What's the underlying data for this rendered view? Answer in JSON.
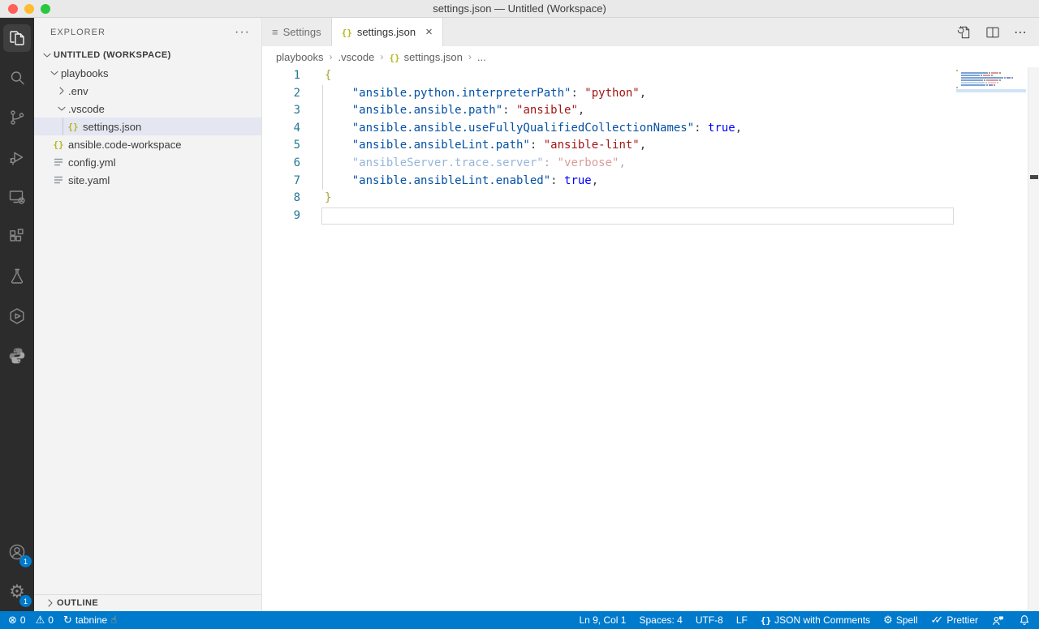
{
  "window": {
    "title": "settings.json — Untitled (Workspace)",
    "controls": [
      "close",
      "minimize",
      "zoom"
    ]
  },
  "activity_bar": {
    "top": [
      {
        "name": "explorer",
        "active": true
      },
      {
        "name": "search",
        "active": false
      },
      {
        "name": "source-control",
        "active": false
      },
      {
        "name": "run-debug",
        "active": false
      },
      {
        "name": "remote-explorer",
        "active": false
      },
      {
        "name": "extensions",
        "active": false
      },
      {
        "name": "testing",
        "active": false
      },
      {
        "name": "hexagon-extension",
        "active": false
      },
      {
        "name": "python",
        "active": false
      }
    ],
    "bottom": [
      {
        "name": "accounts",
        "badge": "1"
      },
      {
        "name": "manage",
        "badge": "1"
      }
    ]
  },
  "sidebar": {
    "title": "EXPLORER",
    "tree": [
      {
        "label": "UNTITLED (WORKSPACE)",
        "type": "section",
        "chevron": "down",
        "indent": 0,
        "bold": true
      },
      {
        "label": "playbooks",
        "type": "folder",
        "chevron": "down",
        "indent": 1
      },
      {
        "label": ".env",
        "type": "folder",
        "chevron": "right",
        "indent": 2
      },
      {
        "label": ".vscode",
        "type": "folder",
        "chevron": "down",
        "indent": 2
      },
      {
        "label": "settings.json",
        "type": "file",
        "icon": "json",
        "indent": 3,
        "selected": true,
        "guide": true
      },
      {
        "label": "ansible.code-workspace",
        "type": "file",
        "icon": "json",
        "indent": 1
      },
      {
        "label": "config.yml",
        "type": "file",
        "icon": "yaml",
        "indent": 1
      },
      {
        "label": "site.yaml",
        "type": "file",
        "icon": "yaml",
        "indent": 1
      }
    ],
    "outline": {
      "label": "OUTLINE"
    }
  },
  "tabs": [
    {
      "label": "Settings",
      "icon": "settings-editor",
      "active": false,
      "close": false
    },
    {
      "label": "settings.json",
      "icon": "json",
      "active": true,
      "close": true
    }
  ],
  "editor_actions": [
    {
      "name": "open-settings-ui"
    },
    {
      "name": "split-editor"
    },
    {
      "name": "more-actions"
    }
  ],
  "breadcrumbs": [
    {
      "label": "playbooks"
    },
    {
      "label": ".vscode"
    },
    {
      "label": "settings.json",
      "icon": "json"
    },
    {
      "label": "..."
    }
  ],
  "editor": {
    "cursor": {
      "line": 9,
      "col": 1
    },
    "lines": [
      {
        "num": "1",
        "indent": 0,
        "segments": [
          {
            "text": "{",
            "style": "bracket"
          }
        ]
      },
      {
        "num": "2",
        "indent": 4,
        "segments": [
          {
            "text": "\"ansible.python.interpreterPath\"",
            "style": "key"
          },
          {
            "text": ": ",
            "style": "punct"
          },
          {
            "text": "\"python\"",
            "style": "str"
          },
          {
            "text": ",",
            "style": "punct"
          }
        ]
      },
      {
        "num": "3",
        "indent": 4,
        "segments": [
          {
            "text": "\"ansible.ansible.path\"",
            "style": "key"
          },
          {
            "text": ": ",
            "style": "punct"
          },
          {
            "text": "\"ansible\"",
            "style": "str"
          },
          {
            "text": ",",
            "style": "punct"
          }
        ]
      },
      {
        "num": "4",
        "indent": 4,
        "segments": [
          {
            "text": "\"ansible.ansible.useFullyQualifiedCollectionNames\"",
            "style": "key"
          },
          {
            "text": ": ",
            "style": "punct"
          },
          {
            "text": "true",
            "style": "bool"
          },
          {
            "text": ",",
            "style": "punct"
          }
        ]
      },
      {
        "num": "5",
        "indent": 4,
        "segments": [
          {
            "text": "\"ansible.ansibleLint.path\"",
            "style": "key"
          },
          {
            "text": ": ",
            "style": "punct"
          },
          {
            "text": "\"ansible-lint\"",
            "style": "str"
          },
          {
            "text": ",",
            "style": "punct"
          }
        ]
      },
      {
        "num": "6",
        "indent": 4,
        "faded": true,
        "segments": [
          {
            "text": "\"ansibleServer.trace.server\"",
            "style": "key"
          },
          {
            "text": ": ",
            "style": "punct"
          },
          {
            "text": "\"verbose\"",
            "style": "str"
          },
          {
            "text": ",",
            "style": "punct"
          }
        ]
      },
      {
        "num": "7",
        "indent": 4,
        "segments": [
          {
            "text": "\"ansible.ansibleLint.enabled\"",
            "style": "key"
          },
          {
            "text": ": ",
            "style": "punct"
          },
          {
            "text": "true",
            "style": "bool"
          },
          {
            "text": ",",
            "style": "punct"
          }
        ]
      },
      {
        "num": "8",
        "indent": 0,
        "segments": [
          {
            "text": "}",
            "style": "bracket"
          }
        ]
      },
      {
        "num": "9",
        "indent": 0,
        "current": true,
        "segments": []
      }
    ]
  },
  "status_bar": {
    "left": [
      {
        "icon": "error",
        "text": "0"
      },
      {
        "icon": "warning",
        "text": "0"
      },
      {
        "icon": "sync",
        "text": "tabnine",
        "trailing_icon": "pointing-hand"
      }
    ],
    "right": [
      {
        "name": "cursor-position",
        "text": "Ln 9, Col 1"
      },
      {
        "name": "indentation",
        "text": "Spaces: 4"
      },
      {
        "name": "encoding",
        "text": "UTF-8"
      },
      {
        "name": "eol",
        "text": "LF"
      },
      {
        "name": "language-mode",
        "icon": "json-braces",
        "text": "JSON with Comments"
      },
      {
        "name": "spell",
        "icon": "gear",
        "text": "Spell"
      },
      {
        "name": "prettier",
        "icon": "double-check",
        "text": "Prettier"
      },
      {
        "name": "feedback",
        "icon": "feedback",
        "text": ""
      },
      {
        "name": "notifications",
        "icon": "bell",
        "text": ""
      }
    ]
  },
  "colors": {
    "status_bar": "#007acc",
    "activity_bar": "#2c2c2c",
    "sidebar": "#f3f3f3",
    "json_key": "#0451a5",
    "json_string": "#a31515",
    "json_bool": "#0000ff",
    "bracket": "#a7a73f",
    "line_number": "#237893",
    "json_file_icon": "#b8b722",
    "selection_bg": "#e4e6f1"
  }
}
